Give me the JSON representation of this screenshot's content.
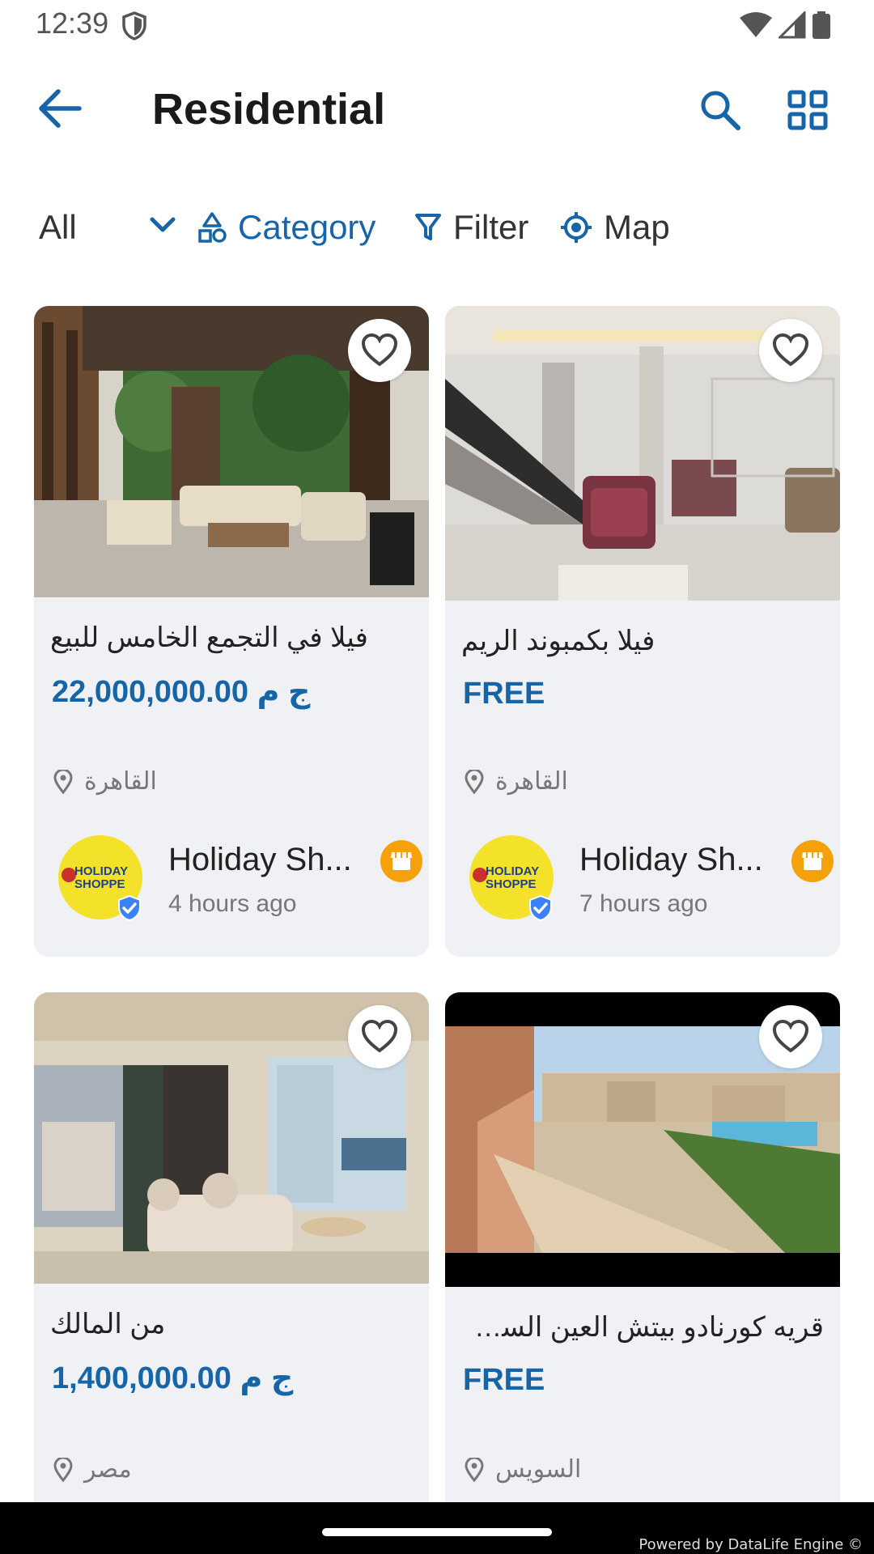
{
  "status_bar": {
    "time": "12:39"
  },
  "app_bar": {
    "title": "Residential"
  },
  "filters": {
    "all_label": "All",
    "category_label": "Category",
    "filter_label": "Filter",
    "map_label": "Map"
  },
  "listings": [
    {
      "title": "فيلا في التجمع الخامس للبيع",
      "price": "22,000,000.00 ج م",
      "location": "القاهرة",
      "seller": {
        "name": "Holiday Sh...",
        "time": "4 hours ago",
        "logo_line1": "HOLIDAY",
        "logo_line2": "SHOPPE"
      }
    },
    {
      "title": "فيلا بكمبوند الريم",
      "price": "FREE",
      "location": "القاهرة",
      "seller": {
        "name": "Holiday Sh...",
        "time": "7 hours ago",
        "logo_line1": "HOLIDAY",
        "logo_line2": "SHOPPE"
      }
    },
    {
      "title": "من المالك",
      "price": "1,400,000.00 ج م",
      "location": "مصر"
    },
    {
      "title": "قريه كورنادو بيتش العين السخنة",
      "price": "FREE",
      "location": "السويس"
    }
  ],
  "footer": {
    "powered_by": "Powered by DataLife Engine ©"
  },
  "colors": {
    "accent": "#1565a8",
    "card_bg": "#f0f1f4",
    "badge": "#f5a20a",
    "verified": "#3b82f6"
  }
}
